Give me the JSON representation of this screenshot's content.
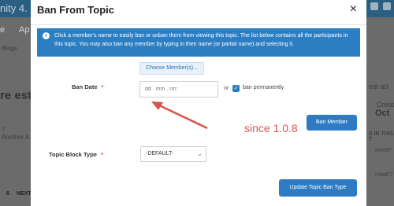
{
  "background": {
    "header_fragment": "nity 4.",
    "left_fragments": [
      "e",
      "Ap",
      "Blogs",
      "re est c",
      "7",
      "",
      "Another A"
    ],
    "bottom_fragment": "NEXT",
    "bottom_number": "6",
    "right_fragments": [
      "est ad",
      "Creat",
      "Oct",
      "S IN THIS T",
      "emy97",
      "mbal77"
    ]
  },
  "modal": {
    "title": "Ban From Topic",
    "close_label": "×",
    "info_icon": "i",
    "info_text": "Click a member's name to easily ban or unban them from viewing this topic. The list below contains all the participants in this topic. You may also ban any member by typing in their name (or partial name) and selecting it.",
    "choose_members_label": "Choose Member(s)...",
    "ban_date_label": "Ban Date",
    "ban_date_placeholder": "dd . mm . rrrr",
    "or_label": "or",
    "ban_permanently_label": "ban permanently",
    "ban_member_button": "Ban Member",
    "annotation": "since 1.0.8",
    "topic_block_type_label": "Topic Block Type",
    "topic_block_type_value": "-DEFAULT-",
    "update_button": "Update Topic Ban Type",
    "required_mark": "*",
    "checkbox_mark": "✓",
    "annotation_color": "#d9534f"
  }
}
